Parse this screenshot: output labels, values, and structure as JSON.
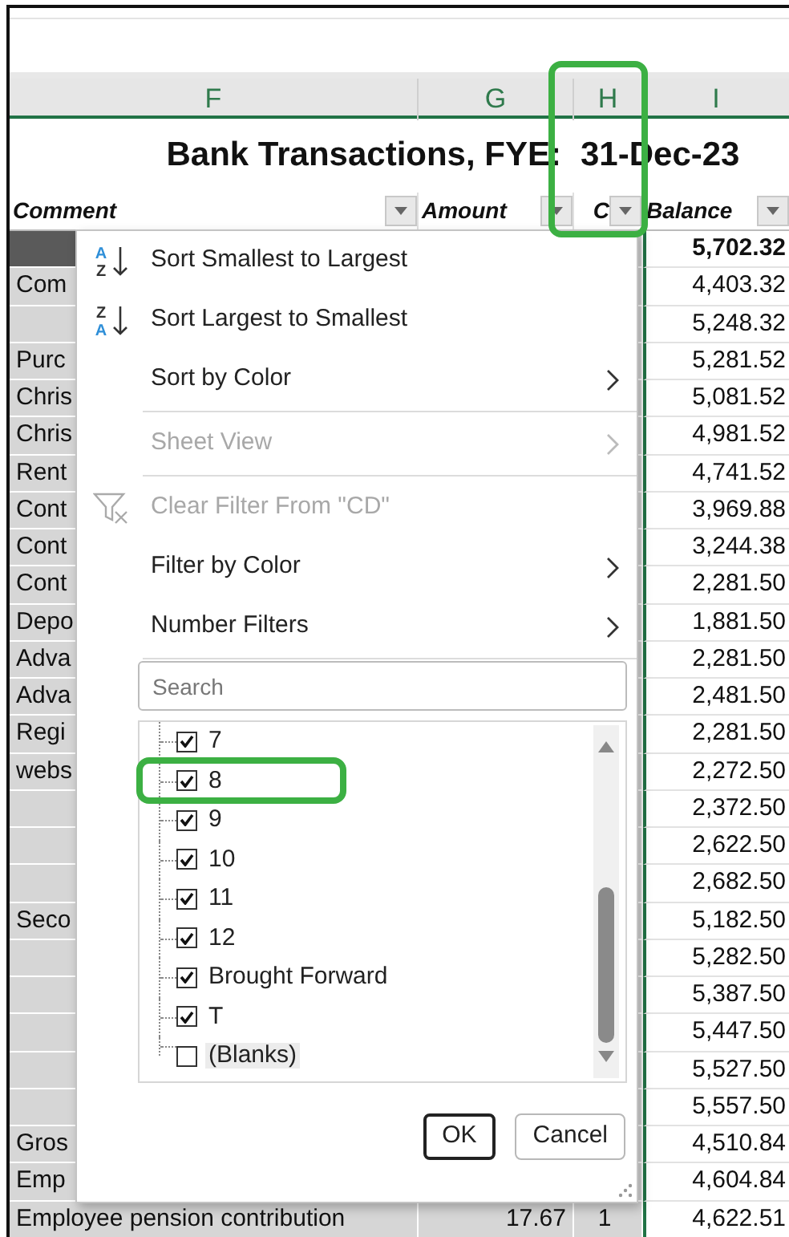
{
  "column_headers": [
    {
      "label": "F"
    },
    {
      "label": "G"
    },
    {
      "label": "H"
    },
    {
      "label": "I"
    }
  ],
  "title": {
    "text": "Bank Transactions, FYE:",
    "date": "31-Dec-23"
  },
  "table": {
    "columns": [
      {
        "label": "Comment"
      },
      {
        "label": "Amount"
      },
      {
        "label": "C"
      },
      {
        "label": "Balance"
      }
    ],
    "rows": [
      {
        "highlighted": true,
        "balance": "5,702.32"
      },
      {
        "highlighted": false,
        "comment": "Com",
        "balance": "4,403.32"
      },
      {
        "highlighted": false,
        "balance": "5,248.32"
      },
      {
        "highlighted": false,
        "comment": "Purc",
        "balance": "5,281.52"
      },
      {
        "highlighted": false,
        "comment": "Chris",
        "balance": "5,081.52"
      },
      {
        "highlighted": false,
        "comment": "Chris",
        "balance": "4,981.52"
      },
      {
        "highlighted": false,
        "comment": "Rent",
        "balance": "4,741.52"
      },
      {
        "highlighted": false,
        "comment": "Cont",
        "balance": "3,969.88"
      },
      {
        "highlighted": false,
        "comment": "Cont",
        "balance": "3,244.38"
      },
      {
        "highlighted": false,
        "comment": "Cont",
        "balance": "2,281.50"
      },
      {
        "highlighted": false,
        "comment": "Depo",
        "balance": "1,881.50"
      },
      {
        "highlighted": false,
        "comment": "Adva",
        "balance": "2,281.50"
      },
      {
        "highlighted": false,
        "comment": "Adva",
        "balance": "2,481.50"
      },
      {
        "highlighted": false,
        "comment": "Regi",
        "balance": "2,281.50"
      },
      {
        "highlighted": false,
        "comment": "webs",
        "balance": "2,272.50"
      },
      {
        "highlighted": false,
        "balance": "2,372.50"
      },
      {
        "highlighted": false,
        "balance": "2,622.50"
      },
      {
        "highlighted": false,
        "balance": "2,682.50"
      },
      {
        "highlighted": false,
        "comment": "Seco",
        "balance": "5,182.50"
      },
      {
        "highlighted": false,
        "balance": "5,282.50"
      },
      {
        "highlighted": false,
        "balance": "5,387.50"
      },
      {
        "highlighted": false,
        "balance": "5,447.50"
      },
      {
        "highlighted": false,
        "balance": "5,527.50"
      },
      {
        "highlighted": false,
        "balance": "5,557.50"
      },
      {
        "highlighted": false,
        "comment": "Gros",
        "balance": "4,510.84"
      },
      {
        "highlighted": false,
        "comment": "Emp",
        "balance": "4,604.84"
      },
      {
        "highlighted": false,
        "comment": "Employee pension contribution",
        "amount": "17.67",
        "c": "1",
        "balance": "4,622.51"
      }
    ]
  },
  "filter_menu": {
    "items": [
      {
        "kind": "sort-ascending",
        "label": "Sort Smallest to Largest",
        "icon_text": [
          "A",
          "Z"
        ],
        "submenu": false,
        "disabled": false
      },
      {
        "kind": "sort-descending",
        "label": "Sort Largest to Smallest",
        "icon_text": [
          "Z",
          "A"
        ],
        "submenu": false,
        "disabled": false
      },
      {
        "kind": "plain",
        "label": "Sort by Color",
        "submenu": true,
        "disabled": false
      },
      {
        "kind": "divider"
      },
      {
        "kind": "plain",
        "label": "Sheet View",
        "submenu": true,
        "disabled": true
      },
      {
        "kind": "divider"
      },
      {
        "kind": "clear-filter",
        "label": "Clear Filter From \"CD\"",
        "submenu": false,
        "disabled": true
      },
      {
        "kind": "plain",
        "label": "Filter by Color",
        "submenu": true,
        "disabled": false
      },
      {
        "kind": "plain",
        "label": "Number Filters",
        "submenu": true,
        "disabled": false
      },
      {
        "kind": "divider"
      }
    ],
    "search": {
      "placeholder": "Search"
    },
    "checklist": [
      {
        "label": "7",
        "checked": true,
        "focused": false
      },
      {
        "label": "8",
        "checked": true,
        "focused": false
      },
      {
        "label": "9",
        "checked": true,
        "focused": false
      },
      {
        "label": "10",
        "checked": true,
        "focused": false
      },
      {
        "label": "11",
        "checked": true,
        "focused": false
      },
      {
        "label": "12",
        "checked": true,
        "focused": false
      },
      {
        "label": "Brought Forward",
        "checked": true,
        "focused": false
      },
      {
        "label": "T",
        "checked": true,
        "focused": false
      },
      {
        "label": "(Blanks)",
        "checked": false,
        "focused": true
      }
    ],
    "buttons": [
      {
        "label": "OK",
        "default": true
      },
      {
        "label": "Cancel",
        "default": false
      }
    ]
  }
}
